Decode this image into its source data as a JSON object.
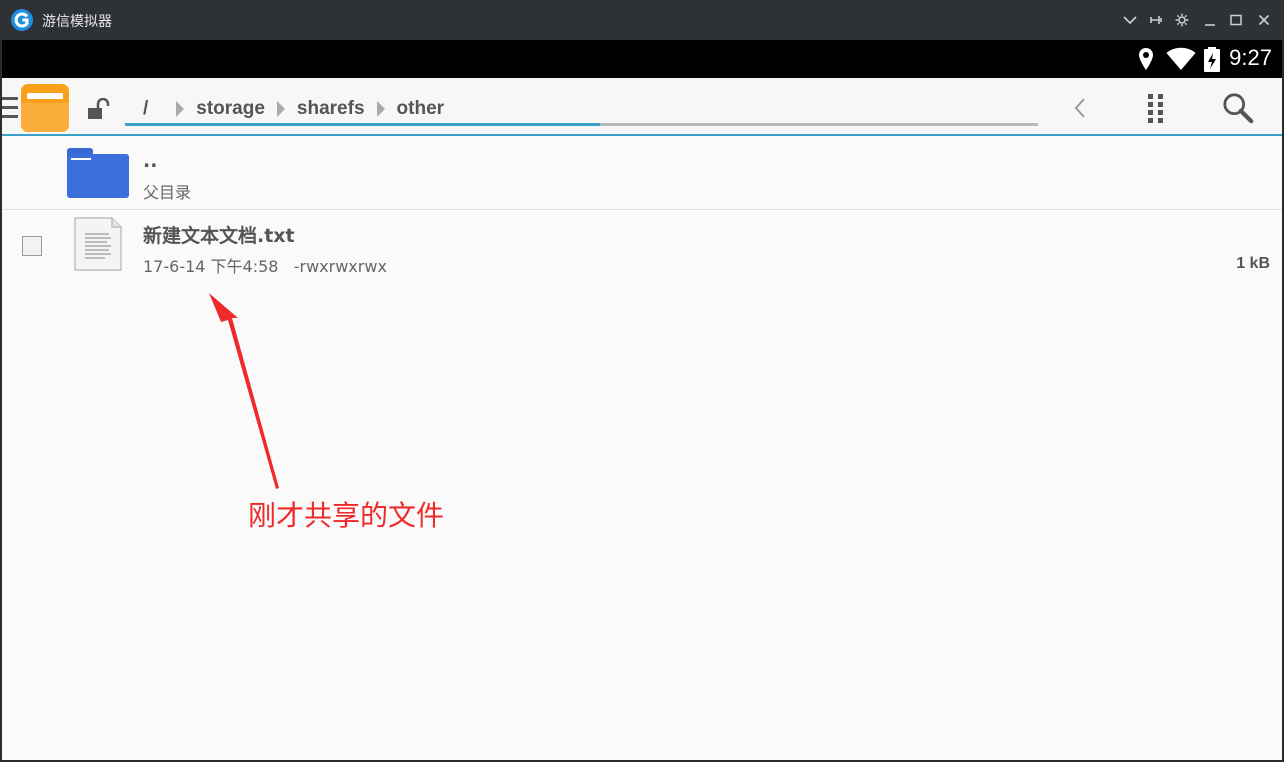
{
  "window": {
    "title": "游信模拟器",
    "controls": [
      "chevron-down-icon",
      "pin-icon",
      "gear-icon",
      "minimize-icon",
      "maximize-icon",
      "close-icon"
    ]
  },
  "status_bar": {
    "time": "9:27",
    "icons": [
      "location-icon",
      "wifi-icon",
      "battery-charging-icon"
    ]
  },
  "toolbar": {
    "breadcrumbs": [
      "/",
      "storage",
      "sharefs",
      "other"
    ],
    "path_progress": 0.52,
    "accent_color": "#3aa0c8"
  },
  "files": {
    "parent": {
      "name": "..",
      "label": "父目录"
    },
    "items": [
      {
        "name": "新建文本文档.txt",
        "date": "17-6-14 下午4:58",
        "permissions": "-rwxrwxrwx",
        "size": "1 kB"
      }
    ]
  },
  "annotation": {
    "text": "刚才共享的文件",
    "color": "#ee2a2a"
  }
}
